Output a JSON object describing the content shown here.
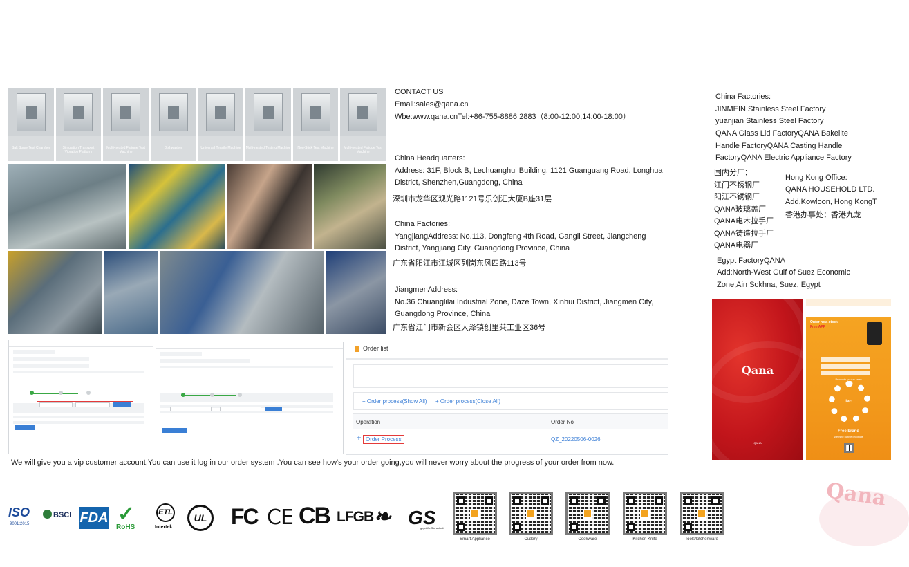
{
  "lab_photos": [
    {
      "caption": "Salt Spray Test Chamber"
    },
    {
      "caption": "Simulation Transport Vibration Platform"
    },
    {
      "caption": "Multi-nested Fatigue Test Machine"
    },
    {
      "caption": "Dishwasher"
    },
    {
      "caption": "Universal Tensile Machine"
    },
    {
      "caption": "Multi-nested Testing Machine"
    },
    {
      "caption": "Non-Stick Test Machine"
    },
    {
      "caption": "Multi-nested Fatigue Test Machine"
    }
  ],
  "contact": {
    "heading": "CONTACT US",
    "email": "Email:sales@qana.cn",
    "web": "Wbe:www.qana.cnTel:+86-755-8886 2883（8:00-12:00,14:00-18:00）"
  },
  "hq": {
    "heading": "China Headquarters:",
    "line1": "Address: 31F, Block B, Lechuanghui Building, 1121 Guanguang Road, Longhua",
    "line2": "District, Shenzhen,Guangdong, China",
    "cn": "深圳市龙华区观光路1121号乐创汇大厦B座31层"
  },
  "yangjiang": {
    "heading": "China Factories:",
    "line1": "YangjiangAddress: No.113, Dongfeng 4th Road, Gangli Street, Jiangcheng",
    "line2": "District, Yangjiang City, Guangdong Province, China",
    "cn": "广东省阳江市江城区列岗东风四路113号"
  },
  "jiangmen": {
    "heading": "JiangmenAddress:",
    "line1": "No.36 Chuanglilai Industrial Zone, Daze Town, Xinhui District, Jiangmen City,",
    "line2": "Guangdong Province, China",
    "cn": "广东省江门市新会区大泽镇创里莱工业区36号"
  },
  "factories": {
    "heading": "China Factories:",
    "lines": [
      "JINMEIN Stainless Steel Factory",
      "yuanjian Stainless Steel Factory",
      "QANA Glass Lid FactoryQANA Bakelite",
      "Handle FactoryQANA Casting Handle",
      "FactoryQANA Electric Appliance Factory"
    ]
  },
  "domestic": {
    "lines": [
      "国内分厂：",
      "江门不锈钢厂",
      "阳江不锈钢厂",
      "QANA玻璃盖厂",
      "QANA电木拉手厂",
      "QANA铸造拉手厂",
      "QANA电器厂"
    ]
  },
  "hongkong": {
    "lines": [
      "Hong Kong Office:",
      "QANA HOUSEHOLD LTD.",
      "Add,Kowloon, Hong KongT",
      "香港办事处：香港九龙"
    ]
  },
  "egypt": {
    "lines": [
      "Egypt FactoryQANA",
      "Add:North-West Gulf of Suez Economic",
      "Zone,Ain Sokhna, Suez, Egypt"
    ]
  },
  "order_list": {
    "title": "Order list",
    "show_all": "+ Order process(Show All)",
    "close_all": "+ Order process(Close All)",
    "col_operation": "Operation",
    "col_order_no": "Order No",
    "process_label": "Order Process",
    "order_no": "QZ_20220506-0026"
  },
  "brochure": {
    "logo": "Qana",
    "logo_small": "QANA",
    "app_title": "Order now-stock",
    "app_badge": "Free APP",
    "app_sub": "Products you've seen",
    "center": "iec",
    "footer1": "Free brand",
    "footer2": "Website native products"
  },
  "vip_note": "We will give you a vip customer account,You can use it log in our order system .You can see how's your order going,you will never worry about the progress of  your order from now.",
  "certifications": {
    "iso": "ISO",
    "iso_sub": "9001:2015",
    "bsci": "BSCI",
    "fda": "FDA",
    "rohs": "RoHS",
    "etl": "ETL",
    "etl_sub": "Intertek",
    "ul": "UL",
    "fc": "FC",
    "ce": "CE",
    "cb": "CB",
    "lfgb": "LFGB",
    "gs": "GS",
    "gs_sub": "geprüfte Sicherheit"
  },
  "qr_codes": [
    {
      "label": "Smart Appliance"
    },
    {
      "label": "Cutlery"
    },
    {
      "label": "Cookware"
    },
    {
      "label": "Kitchen Knife"
    },
    {
      "label": "Tools/kitchenware"
    }
  ],
  "watermark": "Qana",
  "colors": {
    "brand_red": "#c2151b",
    "brand_orange": "#f39a1c",
    "link_blue": "#3c7fd6",
    "highlight_red": "#e43a3a",
    "progress_green": "#3aa845"
  }
}
